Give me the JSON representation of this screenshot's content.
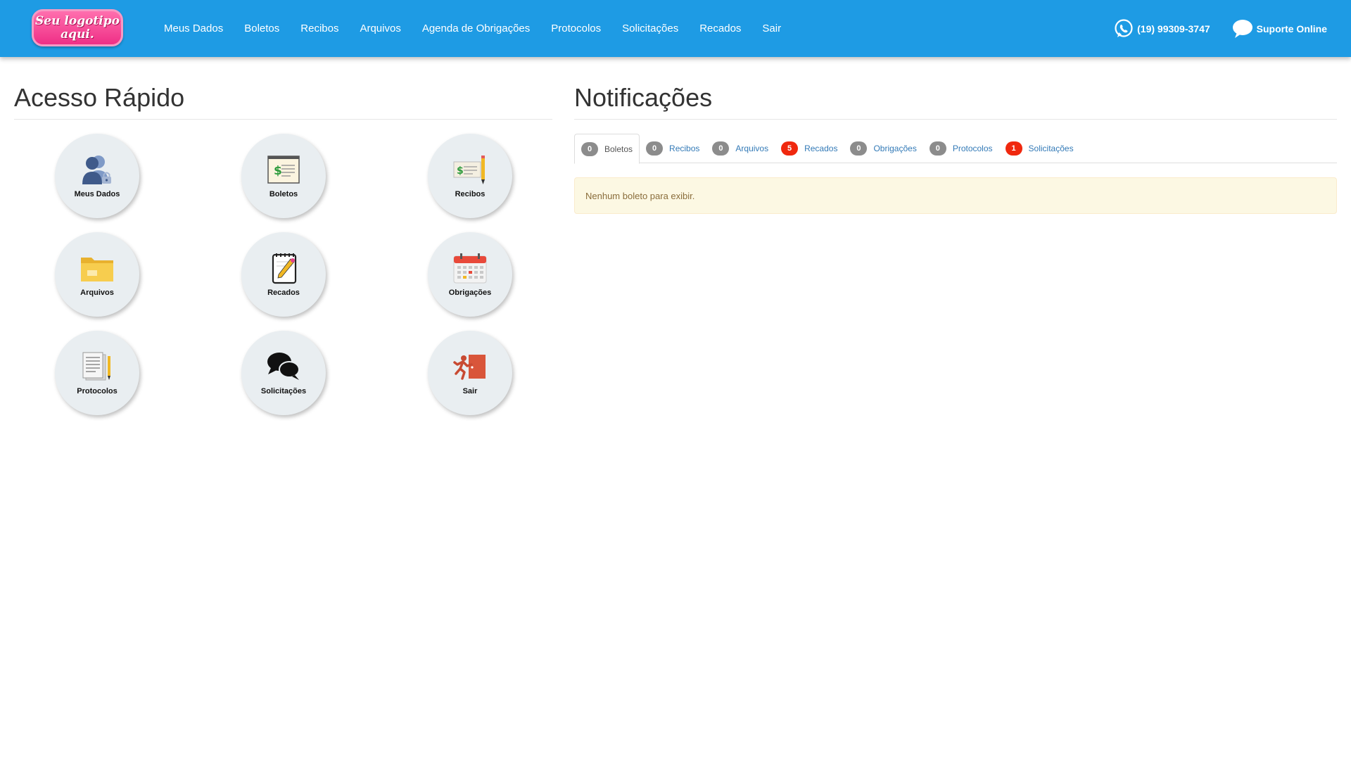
{
  "header": {
    "logo_text": "Seu logotipo aqui.",
    "nav": [
      "Meus Dados",
      "Boletos",
      "Recibos",
      "Arquivos",
      "Agenda de Obrigações",
      "Protocolos",
      "Solicitações",
      "Recados",
      "Sair"
    ],
    "phone": "(19) 99309-3747",
    "support": "Suporte Online"
  },
  "quick_access": {
    "title": "Acesso Rápido",
    "tiles": [
      {
        "label": "Meus Dados",
        "icon": "users-lock-icon"
      },
      {
        "label": "Boletos",
        "icon": "invoice-icon"
      },
      {
        "label": "Recibos",
        "icon": "receipt-icon"
      },
      {
        "label": "Arquivos",
        "icon": "folder-icon"
      },
      {
        "label": "Recados",
        "icon": "notepad-icon"
      },
      {
        "label": "Obrigações",
        "icon": "calendar-icon"
      },
      {
        "label": "Protocolos",
        "icon": "document-pencil-icon"
      },
      {
        "label": "Solicitações",
        "icon": "chat-bubbles-icon"
      },
      {
        "label": "Sair",
        "icon": "exit-door-icon"
      }
    ]
  },
  "notifications": {
    "title": "Notificações",
    "tabs": [
      {
        "count": "0",
        "label": "Boletos",
        "active": true,
        "highlight": false
      },
      {
        "count": "0",
        "label": "Recibos",
        "active": false,
        "highlight": false
      },
      {
        "count": "0",
        "label": "Arquivos",
        "active": false,
        "highlight": false
      },
      {
        "count": "5",
        "label": "Recados",
        "active": false,
        "highlight": true
      },
      {
        "count": "0",
        "label": "Obrigações",
        "active": false,
        "highlight": false
      },
      {
        "count": "0",
        "label": "Protocolos",
        "active": false,
        "highlight": false
      },
      {
        "count": "1",
        "label": "Solicitações",
        "active": false,
        "highlight": true
      }
    ],
    "message": "Nenhum boleto para exibir."
  },
  "colors": {
    "navbar": "#1e9be4",
    "logo": "#ef2f86",
    "badge_gray": "#8c8c8c",
    "badge_red": "#f0280e",
    "alert_bg": "#fcf8e3",
    "alert_text": "#8a6d3b",
    "link": "#337ab7"
  }
}
